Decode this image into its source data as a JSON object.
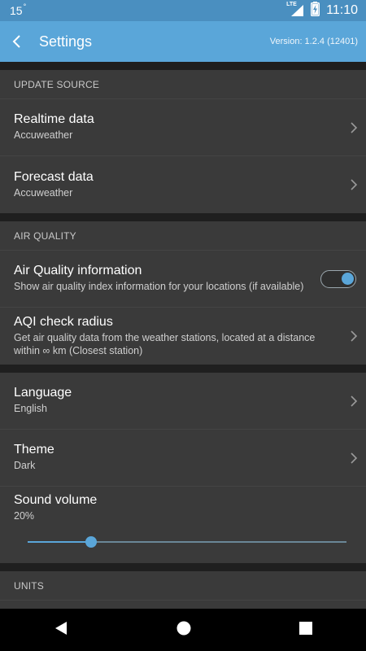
{
  "status_bar": {
    "temperature": "15",
    "degree": "°",
    "network": "LTE",
    "time": "11:10"
  },
  "app_bar": {
    "title": "Settings",
    "version": "Version: 1.2.4 (12401)"
  },
  "sections": {
    "update_source": {
      "header": "UPDATE SOURCE",
      "realtime": {
        "label": "Realtime data",
        "value": "Accuweather"
      },
      "forecast": {
        "label": "Forecast data",
        "value": "Accuweather"
      }
    },
    "air_quality": {
      "header": "AIR QUALITY",
      "info": {
        "label": "Air Quality information",
        "description": "Show air quality index information for your locations (if available)",
        "enabled": true
      },
      "radius": {
        "label": "AQI check radius",
        "description": "Get air quality data from the weather stations, located at a distance within ∞ km (Closest station)"
      }
    },
    "general": {
      "language": {
        "label": "Language",
        "value": "English"
      },
      "theme": {
        "label": "Theme",
        "value": "Dark"
      },
      "sound": {
        "label": "Sound volume",
        "value": "20%",
        "level_percent": 20
      }
    },
    "units": {
      "header": "UNITS"
    }
  },
  "colors": {
    "accent": "#5aa6d9",
    "status_bar": "#4a8fc0",
    "background": "#3a3a3a"
  },
  "icons": {
    "back": "back-arrow-icon",
    "chevron": "chevron-right-icon",
    "signal": "signal-icon",
    "battery": "battery-charging-icon",
    "nav_back": "nav-back-icon",
    "nav_home": "nav-home-icon",
    "nav_recents": "nav-recents-icon"
  }
}
